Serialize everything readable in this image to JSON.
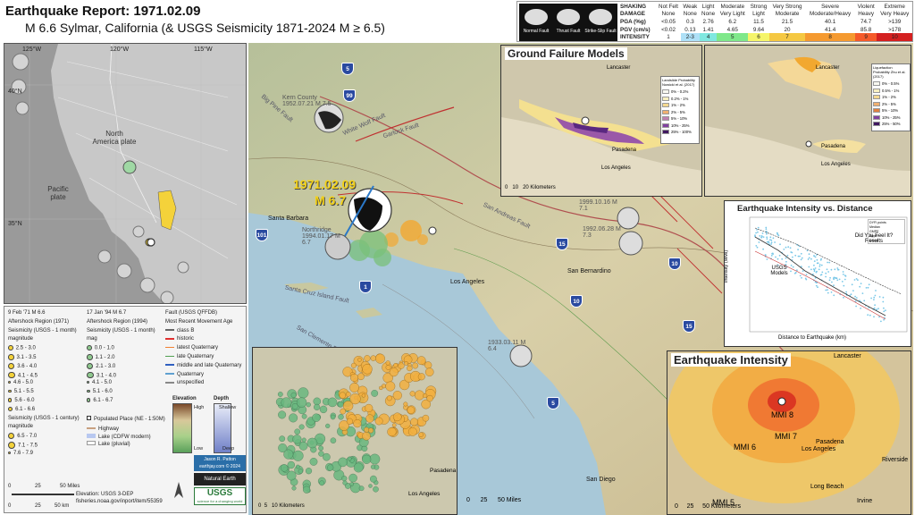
{
  "header": {
    "title_line1": "Earthquake Report: 1971.02.09",
    "title_line2": "M 6.6 Sylmar, California (& USGS Seismicity 1871-2024 M ≥ 6.5)"
  },
  "shaking_table": {
    "beachball_labels": [
      "Normal Fault",
      "Thrust Fault",
      "Strike-Slip Fault"
    ],
    "rows": [
      {
        "label": "SHAKING",
        "cells": [
          "Not Felt",
          "Weak",
          "Light",
          "Moderate",
          "Strong",
          "Very Strong",
          "Severe",
          "Violent",
          "Extreme"
        ]
      },
      {
        "label": "DAMAGE",
        "cells": [
          "None",
          "None",
          "None",
          "Very Light",
          "Light",
          "Moderate",
          "Moderate/Heavy",
          "Heavy",
          "Very Heavy"
        ]
      },
      {
        "label": "PGA (%g)",
        "cells": [
          "<0.05",
          "0.3",
          "2.76",
          "6.2",
          "11.5",
          "21.5",
          "40.1",
          "74.7",
          ">139"
        ]
      },
      {
        "label": "PGV (cm/s)",
        "cells": [
          "<0.02",
          "0.13",
          "1.41",
          "4.65",
          "9.64",
          "20",
          "41.4",
          "85.8",
          ">178"
        ]
      },
      {
        "label": "INTENSITY",
        "cells": [
          "1",
          "2-3",
          "4",
          "5",
          "6",
          "7",
          "8",
          "9",
          "10"
        ]
      }
    ],
    "intensity_colors": [
      "#ffffff",
      "#aee0f7",
      "#7fe8e0",
      "#7fe88a",
      "#f5f56a",
      "#f5c842",
      "#f59a30",
      "#f55a2a",
      "#d42020"
    ]
  },
  "left_map": {
    "lon_labels": [
      "125°W",
      "120°W",
      "115°W"
    ],
    "lat_labels": [
      "40°N",
      "35°N"
    ],
    "plate_labels": [
      "North America plate",
      "Pacific plate"
    ]
  },
  "left_legend": {
    "col1": [
      "9 Feb '71 M 6.6",
      "Aftershock Region (1971)",
      "Seismicity (USGS - 1 month)",
      "magnitude",
      "2.5 - 3.0",
      "3.1 - 3.5",
      "3.6 - 4.0",
      "4.1 - 4.5",
      "4.6 - 5.0",
      "5.1 - 5.5",
      "5.6 - 6.0",
      "6.1 - 6.6",
      "Seismicity (USGS - 1 century)",
      "magnitude",
      "6.5 - 7.0",
      "7.1 - 7.5",
      "7.6 - 7.9"
    ],
    "col2": [
      "17 Jan '94 M 6.7",
      "Aftershock Region (1994)",
      "Seismicity (USGS - 1 month)",
      "mag",
      "0.0 - 1.0",
      "1.1 - 2.0",
      "2.1 - 3.0",
      "3.1 - 4.0",
      "4.1 - 5.0",
      "5.1 - 6.0",
      "6.1 - 6.7"
    ],
    "col3": [
      "Fault (USGS QFFDB)",
      "Most Recent Movement Age",
      "class B",
      "historic",
      "latest Quaternary",
      "late Quaternary",
      "middle and late Quaternary",
      "Quaternary",
      "unspecified"
    ],
    "elevation": {
      "title": "Elevation",
      "high": "High",
      "low": "Low"
    },
    "depth": {
      "title": "Depth",
      "shallow": "Shallow",
      "deep": "Deep"
    },
    "populated": "Populated Place (NE - 1:50M)",
    "highway": "Highway",
    "lake1": "Lake (CDFW modern)",
    "lake2": "Lake (pluvial)",
    "credit1": "Jason R. Patton",
    "credit2": "earthjay.com © 2024",
    "natural_earth": "Natural Earth",
    "usgs": "USGS",
    "usgs_sub": "science for a changing world",
    "elevation_src": "Elevation: USGS 3-DEP",
    "url": "fisheries.noaa.gov/inport/item/55359",
    "scale_miles": [
      "0",
      "25",
      "50 Miles"
    ],
    "scale_km": [
      "0",
      "25",
      "50 km"
    ]
  },
  "main_map": {
    "eq_date": "1971.02.09",
    "eq_mag": "M 6.7",
    "labels": {
      "santa_barbara": "Santa Barbara",
      "los_angeles": "Los Angeles",
      "san_bernardino": "San Bernardino",
      "san_diego": "San Diego",
      "pasadena": "Pasadena",
      "lancaster": "Lancaster",
      "santa_cruz": "Santa Cruz Island Fault",
      "san_andreas": "San Andreas Fault",
      "garlock": "Garlock Fault",
      "big_pine": "Big Pine Fault",
      "san_clemente": "San Clemente Fault",
      "white_wolf": "White Wolf Fault",
      "kern": "Kern County 1952.07.21 M 7.5",
      "northridge": "Northridge 1994.01.17 M 6.7",
      "hector": "1999.10.16 M 7.1",
      "landers": "1992.06.28 M 7.3",
      "baja": "1933.03.11 M 6.4",
      "highways": [
        "5",
        "99",
        "15",
        "101",
        "10",
        "1",
        "5",
        "15",
        "10",
        "5"
      ]
    },
    "scale": [
      "0",
      "25",
      "50 Miles"
    ]
  },
  "ground_failure": {
    "title": "Ground Failure Models",
    "panel1_legend_title": "Landslide Probability Nowicki et al. (2017)",
    "panel1_legend": [
      "0% - 0.2%",
      "0.2% - 1%",
      "1% - 2%",
      "2% - 5%",
      "5% - 10%",
      "10% - 25%",
      "25% - 100%"
    ],
    "panel2_legend_title": "Liquefaction Probability Zhu et al. (2017)",
    "panel2_legend": [
      "0% - 0.5%",
      "0.5% - 1%",
      "1% - 2%",
      "2% - 5%",
      "5% - 10%",
      "10% - 25%",
      "25% - 50%"
    ],
    "places": {
      "lancaster": "Lancaster",
      "pasadena": "Pasadena",
      "los_angeles": "Los Angeles"
    },
    "scale": [
      "0",
      "10",
      "20 Kilometers"
    ]
  },
  "intensity_chart": {
    "title": "Earthquake Intensity vs. Distance",
    "ylabel": "Intensity (MMI)",
    "xlabel": "Distance to Earthquake (km)",
    "annotation1": "Did You Feel It? Results",
    "annotation2": "USGS Models",
    "legend": [
      "DYFI points",
      "Median",
      "GMPE",
      "Upper",
      "Lower"
    ]
  },
  "eq_intensity": {
    "title": "Earthquake Intensity",
    "labels": [
      "MMI 8",
      "MMI 7",
      "MMI 6",
      "MMI 5"
    ],
    "places": {
      "lancaster": "Lancaster",
      "pasadena": "Pasadena",
      "los_angeles": "Los Angeles",
      "long_beach": "Long Beach",
      "riverside": "Riverside",
      "irvine": "Irvine"
    },
    "scale": [
      "0",
      "25",
      "50 Kilometers"
    ]
  },
  "bottom_inset": {
    "places": {
      "pasadena": "Pasadena",
      "los_angeles": "Los Angeles"
    },
    "scale": [
      "0",
      "5",
      "10 Kilometers"
    ]
  }
}
